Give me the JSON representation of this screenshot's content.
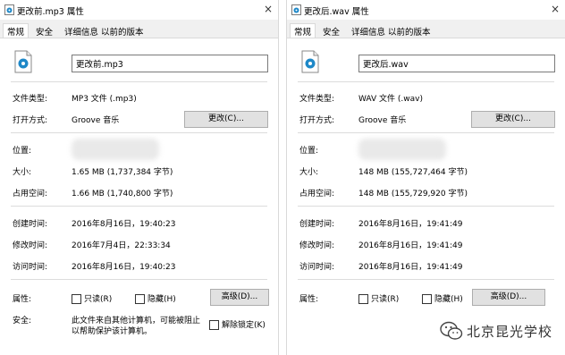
{
  "left": {
    "title": "更改前.mp3 属性",
    "close": "×",
    "tabs": [
      "常规",
      "安全",
      "详细信息",
      "以前的版本"
    ],
    "filename": "更改前.mp3",
    "file_type_label": "文件类型:",
    "file_type": "MP3 文件 (.mp3)",
    "open_with_label": "打开方式:",
    "open_with": "Groove 音乐",
    "change_btn": "更改(C)...",
    "location_label": "位置:",
    "size_label": "大小:",
    "size": "1.65 MB (1,737,384 字节)",
    "disk_label": "占用空间:",
    "disk": "1.66 MB (1,740,800 字节)",
    "created_label": "创建时间:",
    "created": "2016年8月16日，19:40:23",
    "modified_label": "修改时间:",
    "modified": "2016年7月4日，22:33:34",
    "accessed_label": "访问时间:",
    "accessed": "2016年8月16日，19:40:23",
    "attr_label": "属性:",
    "readonly": "只读(R)",
    "hidden": "隐藏(H)",
    "advanced_btn": "高级(D)...",
    "security_label": "安全:",
    "security_text_1": "此文件来自其他计算机，可能被阻止",
    "security_text_2": "以帮助保护该计算机。",
    "unblock": "解除锁定(K)"
  },
  "right": {
    "title": "更改后.wav 属性",
    "close": "×",
    "tabs": [
      "常规",
      "安全",
      "详细信息",
      "以前的版本"
    ],
    "filename": "更改后.wav",
    "file_type_label": "文件类型:",
    "file_type": "WAV 文件 (.wav)",
    "open_with_label": "打开方式:",
    "open_with": "Groove 音乐",
    "change_btn": "更改(C)...",
    "location_label": "位置:",
    "size_label": "大小:",
    "size": "148 MB (155,727,464 字节)",
    "disk_label": "占用空间:",
    "disk": "148 MB (155,729,920 字节)",
    "created_label": "创建时间:",
    "created": "2016年8月16日，19:41:49",
    "modified_label": "修改时间:",
    "modified": "2016年8月16日，19:41:49",
    "accessed_label": "访问时间:",
    "accessed": "2016年8月16日，19:41:49",
    "attr_label": "属性:",
    "readonly": "只读(R)",
    "hidden": "隐藏(H)",
    "advanced_btn": "高级(D)..."
  },
  "watermark": {
    "text": "北京昆光学校"
  },
  "colors": {
    "accent": "#1e88c8",
    "dialog_bg": "#f0f0f0",
    "button_bg": "#e1e1e1"
  }
}
